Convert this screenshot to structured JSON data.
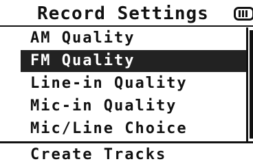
{
  "header": {
    "title": "Record Settings",
    "battery_icon": "battery-icon"
  },
  "menu": {
    "items": [
      {
        "label": "AM Quality",
        "selected": false
      },
      {
        "label": "FM Quality",
        "selected": true
      },
      {
        "label": "Line-in Quality",
        "selected": false
      },
      {
        "label": "Mic-in Quality",
        "selected": false
      },
      {
        "label": "Mic/Line Choice",
        "selected": false
      }
    ],
    "next_item": "Create Tracks"
  },
  "colors": {
    "background": "#ffffff",
    "text": "#111111",
    "highlight": "#222222",
    "highlight_text": "#ffffff"
  }
}
